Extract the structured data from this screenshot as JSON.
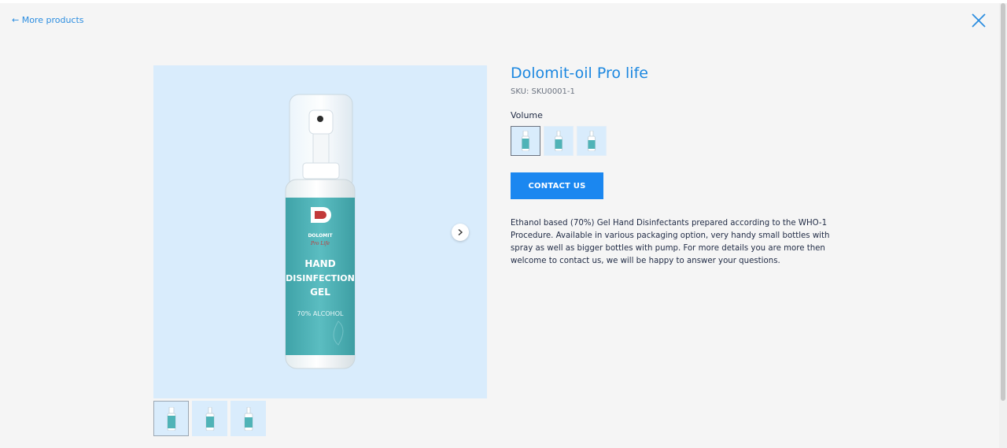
{
  "nav": {
    "back_label": "← More products",
    "close_icon": "close-icon"
  },
  "product": {
    "title": "Dolomit-oil Pro life",
    "sku": "SKU: SKU0001-1",
    "volume_label": "Volume",
    "contact_label": "CONTACT US",
    "description": "Ethanol based (70%) Gel Hand Disinfectants prepared according to the WHO-1 Procedure. Available in various packaging option, very handy small bottles with spray as well as bigger bottles with pump. For more details you are more then welcome to contact us, we will be happy to answer your questions."
  },
  "bottle_label": {
    "brand": "DOLOMIT",
    "script": "Pro Life",
    "line1": "HAND",
    "line2": "DISINFECTION",
    "line3": "GEL",
    "line4": "70% ALCOHOL"
  },
  "gallery": {
    "next_icon": "chevron-right-icon",
    "selected_thumbnail_index": 0,
    "selected_volume_index": 0
  },
  "colors": {
    "accent": "#1b87f0",
    "image_bg": "#d9ecfc",
    "bottle_label": "#4fb3b7"
  }
}
